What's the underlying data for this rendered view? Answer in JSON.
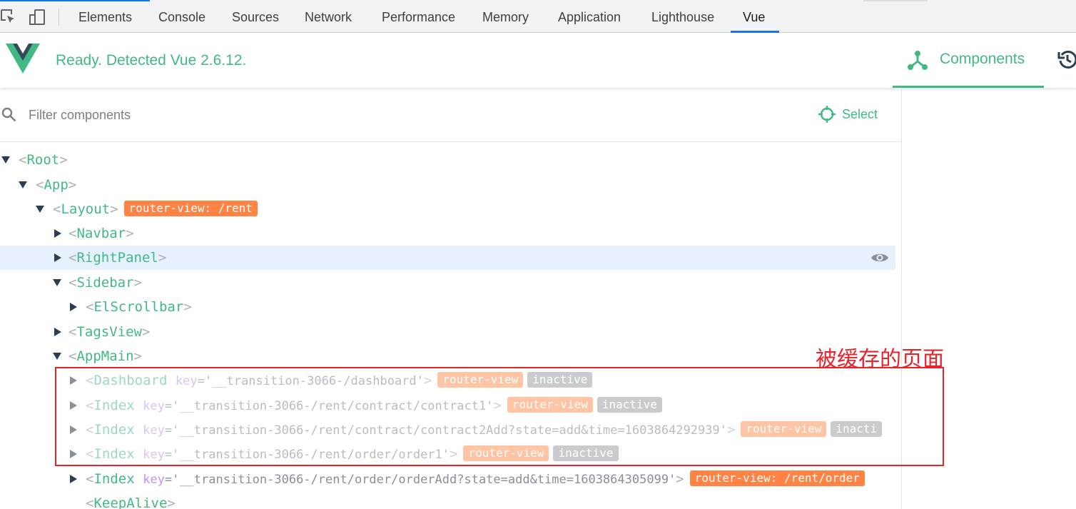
{
  "devtools": {
    "tabs": [
      {
        "label": "Elements"
      },
      {
        "label": "Console"
      },
      {
        "label": "Sources"
      },
      {
        "label": "Network"
      },
      {
        "label": "Performance"
      },
      {
        "label": "Memory"
      },
      {
        "label": "Application"
      },
      {
        "label": "Lighthouse"
      },
      {
        "label": "Vue"
      }
    ],
    "active_tab": "Vue",
    "accent_color": "#1a73e8"
  },
  "vue": {
    "status": "Ready. Detected Vue 2.6.12.",
    "brand_color": "#42b983",
    "components_tab": "Components"
  },
  "filter": {
    "placeholder": "Filter components",
    "value": "",
    "select_label": "Select"
  },
  "tree": [
    {
      "name": "Root",
      "expanded": true,
      "suffix": ""
    },
    {
      "name": "App",
      "expanded": true,
      "suffix": ""
    },
    {
      "name": "Layout",
      "expanded": true,
      "suffix": "",
      "badges": [
        "router-view: /rent"
      ]
    },
    {
      "name": "Navbar",
      "expanded": false,
      "suffix": ""
    },
    {
      "name": "RightPanel",
      "expanded": false,
      "suffix": "",
      "selected": true
    },
    {
      "name": "Sidebar",
      "expanded": true,
      "suffix": ""
    },
    {
      "name": "ElScrollbar",
      "expanded": false,
      "suffix": ""
    },
    {
      "name": "TagsView",
      "expanded": false,
      "suffix": ""
    },
    {
      "name": "AppMain",
      "expanded": true,
      "suffix": ""
    },
    {
      "name": "Dashboard",
      "key": "key",
      "value": "'__transition-3066-/dashboard'",
      "badges": [
        "router-view",
        "inactive"
      ],
      "inactive": true
    },
    {
      "name": "Index",
      "key": "key",
      "value": "'__transition-3066-/rent/contract/contract1'",
      "badges": [
        "router-view",
        "inactive"
      ],
      "inactive": true
    },
    {
      "name": "Index",
      "key": "key",
      "value": "'__transition-3066-/rent/contract/contract2Add?state=add&time=1603864292939'",
      "badges": [
        "router-view",
        "inacti"
      ],
      "inactive": true
    },
    {
      "name": "Index",
      "key": "key",
      "value": "'__transition-3066-/rent/order/order1'",
      "badges": [
        "router-view",
        "inactive"
      ],
      "inactive": true
    },
    {
      "name": "Index",
      "key": "key",
      "value": "'__transition-3066-/rent/order/orderAdd?state=add&time=1603864305099'",
      "badges": [
        "router-view: /rent/order"
      ],
      "inactive": false
    },
    {
      "name": "KeepAlive",
      "suffix": ""
    }
  ],
  "annotation": {
    "text": "被缓存的页面",
    "color": "#e8232a"
  },
  "icons": {
    "inspect": "inspect-element-icon",
    "device": "device-toolbar-icon",
    "vue_logo": "vue-logo-icon",
    "components": "components-tree-icon",
    "history": "history-icon",
    "search": "search-icon",
    "select": "crosshair-select-icon",
    "eye": "eye-icon"
  }
}
